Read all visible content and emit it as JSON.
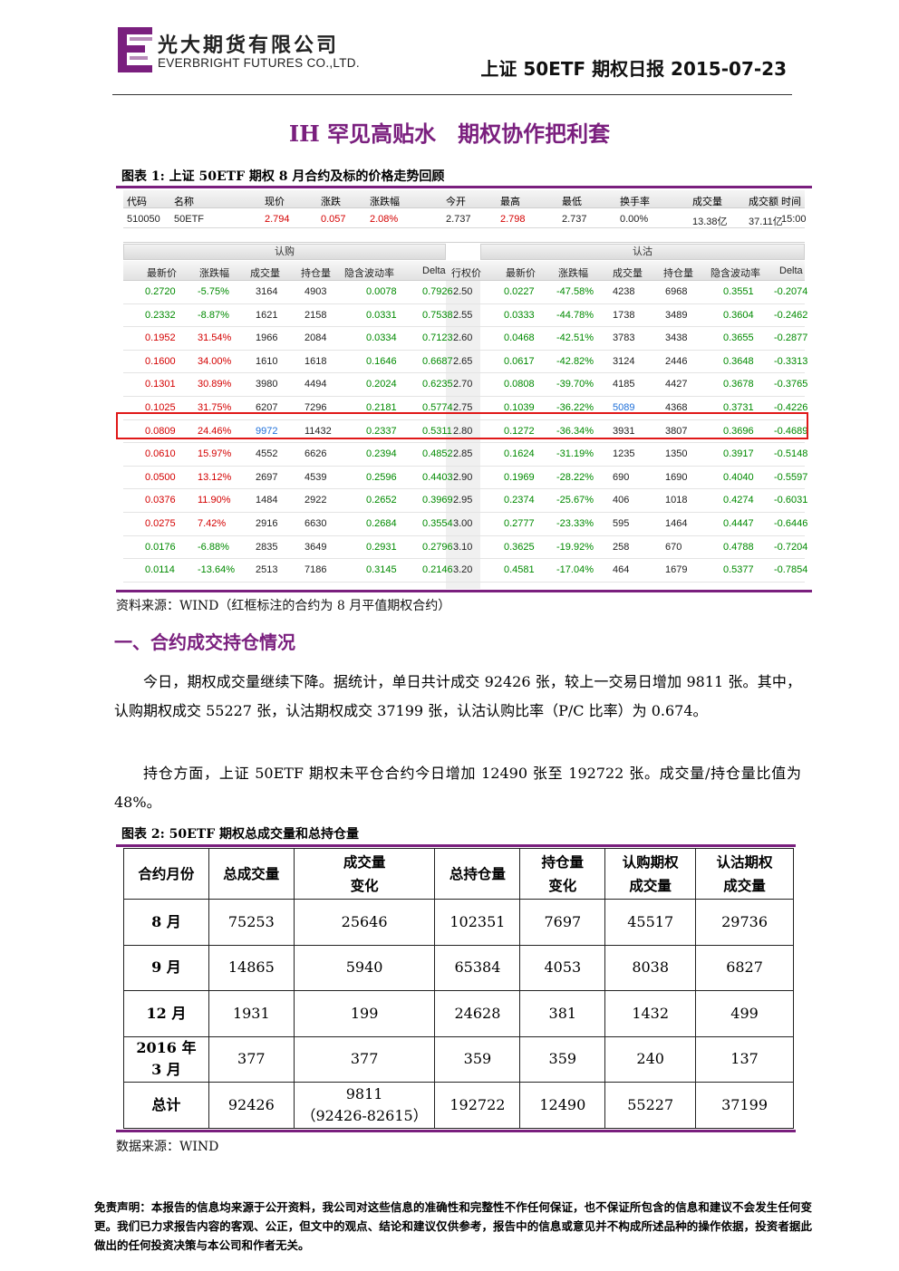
{
  "header": {
    "logo_cn": "光大期货有限公司",
    "logo_en": "EVERBRIGHT FUTURES CO.,LTD.",
    "report_title": "上证 50ETF 期权日报 2015-07-23"
  },
  "main_title": "IH 罕见高贴水　期权协作把利套",
  "figure1": {
    "caption": "图表 1:  上证 50ETF 期权 8 月合约及标的价格走势回顾",
    "quote_header": [
      "代码",
      "名称",
      "现价",
      "涨跌",
      "涨跌幅",
      "今开",
      "最高",
      "最低",
      "换手率",
      "成交量",
      "成交额",
      "时间"
    ],
    "quote_values": [
      "510050",
      "50ETF",
      "2.794",
      "0.057",
      "2.08%",
      "2.737",
      "2.798",
      "2.737",
      "0.00%",
      "13.38亿",
      "37.11亿",
      "15:00"
    ],
    "call_band": "认购",
    "put_band": "认沽",
    "columns_call": [
      "最新价",
      "涨跌幅",
      "成交量",
      "持仓量",
      "隐含波动率",
      "Delta"
    ],
    "column_strike": "行权价",
    "columns_put": [
      "最新价",
      "涨跌幅",
      "成交量",
      "持仓量",
      "隐含波动率",
      "Delta"
    ],
    "rows": [
      [
        "0.2720",
        "-5.75%",
        "3164",
        "4903",
        "0.0078",
        "0.7926",
        "2.50",
        "0.0227",
        "-47.58%",
        "4238",
        "6968",
        "0.3551",
        "-0.2074"
      ],
      [
        "0.2332",
        "-8.87%",
        "1621",
        "2158",
        "0.0331",
        "0.7538",
        "2.55",
        "0.0333",
        "-44.78%",
        "1738",
        "3489",
        "0.3604",
        "-0.2462"
      ],
      [
        "0.1952",
        "31.54%",
        "1966",
        "2084",
        "0.0334",
        "0.7123",
        "2.60",
        "0.0468",
        "-42.51%",
        "3783",
        "3438",
        "0.3655",
        "-0.2877"
      ],
      [
        "0.1600",
        "34.00%",
        "1610",
        "1618",
        "0.1646",
        "0.6687",
        "2.65",
        "0.0617",
        "-42.82%",
        "3124",
        "2446",
        "0.3648",
        "-0.3313"
      ],
      [
        "0.1301",
        "30.89%",
        "3980",
        "4494",
        "0.2024",
        "0.6235",
        "2.70",
        "0.0808",
        "-39.70%",
        "4185",
        "4427",
        "0.3678",
        "-0.3765"
      ],
      [
        "0.1025",
        "31.75%",
        "6207",
        "7296",
        "0.2181",
        "0.5774",
        "2.75",
        "0.1039",
        "-36.22%",
        "5089",
        "4368",
        "0.3731",
        "-0.4226"
      ],
      [
        "0.0809",
        "24.46%",
        "9972",
        "11432",
        "0.2337",
        "0.5311",
        "2.80",
        "0.1272",
        "-36.34%",
        "3931",
        "3807",
        "0.3696",
        "-0.4689"
      ],
      [
        "0.0610",
        "15.97%",
        "4552",
        "6626",
        "0.2394",
        "0.4852",
        "2.85",
        "0.1624",
        "-31.19%",
        "1235",
        "1350",
        "0.3917",
        "-0.5148"
      ],
      [
        "0.0500",
        "13.12%",
        "2697",
        "4539",
        "0.2596",
        "0.4403",
        "2.90",
        "0.1969",
        "-28.22%",
        "690",
        "1690",
        "0.4040",
        "-0.5597"
      ],
      [
        "0.0376",
        "11.90%",
        "1484",
        "2922",
        "0.2652",
        "0.3969",
        "2.95",
        "0.2374",
        "-25.67%",
        "406",
        "1018",
        "0.4274",
        "-0.6031"
      ],
      [
        "0.0275",
        "7.42%",
        "2916",
        "6630",
        "0.2684",
        "0.3554",
        "3.00",
        "0.2777",
        "-23.33%",
        "595",
        "1464",
        "0.4447",
        "-0.6446"
      ],
      [
        "0.0176",
        "-6.88%",
        "2835",
        "3649",
        "0.2931",
        "0.2796",
        "3.10",
        "0.3625",
        "-19.92%",
        "258",
        "670",
        "0.4788",
        "-0.7204"
      ],
      [
        "0.0114",
        "-13.64%",
        "2513",
        "7186",
        "0.3145",
        "0.2146",
        "3.20",
        "0.4581",
        "-17.04%",
        "464",
        "1679",
        "0.5377",
        "-0.7854"
      ]
    ],
    "source": "资料来源：WIND（红框标注的合约为 8 月平值期权合约）"
  },
  "section1": {
    "heading": "一、合约成交持仓情况",
    "para1": "今日，期权成交量继续下降。据统计，单日共计成交 92426 张，较上一交易日增加 9811 张。其中，认购期权成交 55227 张，认沽期权成交 37199 张，认沽认购比率（P/C 比率）为 0.674。",
    "para2": "持仓方面，上证 50ETF 期权未平仓合约今日增加 12490 张至 192722 张。成交量/持仓量比值为 48%。"
  },
  "figure2": {
    "caption": "图表 2:  50ETF 期权总成交量和总持仓量",
    "headers": [
      "合约月份",
      "总成交量",
      "成交量",
      "变化",
      "总持仓量",
      "持仓量",
      "变化",
      "认购期权",
      "成交量",
      "认沽期权",
      "成交量"
    ],
    "rows": [
      {
        "month": "8 月",
        "month2": "",
        "vol": "75253",
        "chg": "25646",
        "chg2": "",
        "oi": "102351",
        "oichg": "7697",
        "call": "45517",
        "put": "29736"
      },
      {
        "month": "9 月",
        "month2": "",
        "vol": "14865",
        "chg": "5940",
        "chg2": "",
        "oi": "65384",
        "oichg": "4053",
        "call": "8038",
        "put": "6827"
      },
      {
        "month": "12 月",
        "month2": "",
        "vol": "1931",
        "chg": "199",
        "chg2": "",
        "oi": "24628",
        "oichg": "381",
        "call": "1432",
        "put": "499"
      },
      {
        "month": "2016 年",
        "month2": "3 月",
        "vol": "377",
        "chg": "377",
        "chg2": "",
        "oi": "359",
        "oichg": "359",
        "call": "240",
        "put": "137"
      },
      {
        "month": "总计",
        "month2": "",
        "vol": "92426",
        "chg": "9811",
        "chg2": "（92426-82615）",
        "oi": "192722",
        "oichg": "12490",
        "call": "55227",
        "put": "37199"
      }
    ],
    "source": "数据来源：WIND"
  },
  "disclaimer": "免责声明：本报告的信息均来源于公开资料，我公司对这些信息的准确性和完整性不作任何保证，也不保证所包含的信息和建议不会发生任何变更。我们已力求报告内容的客观、公正，但文中的观点、结论和建议仅供参考，报告中的信息或意见并不构成所述品种的操作依据，投资者据此做出的任何投资决策与本公司和作者无关。",
  "colors": {
    "brand_purple": "#7a1f7e",
    "up_red": "#d40000",
    "down_green": "#008a00",
    "blue": "#1e6fd9",
    "box_red": "#e01818"
  }
}
